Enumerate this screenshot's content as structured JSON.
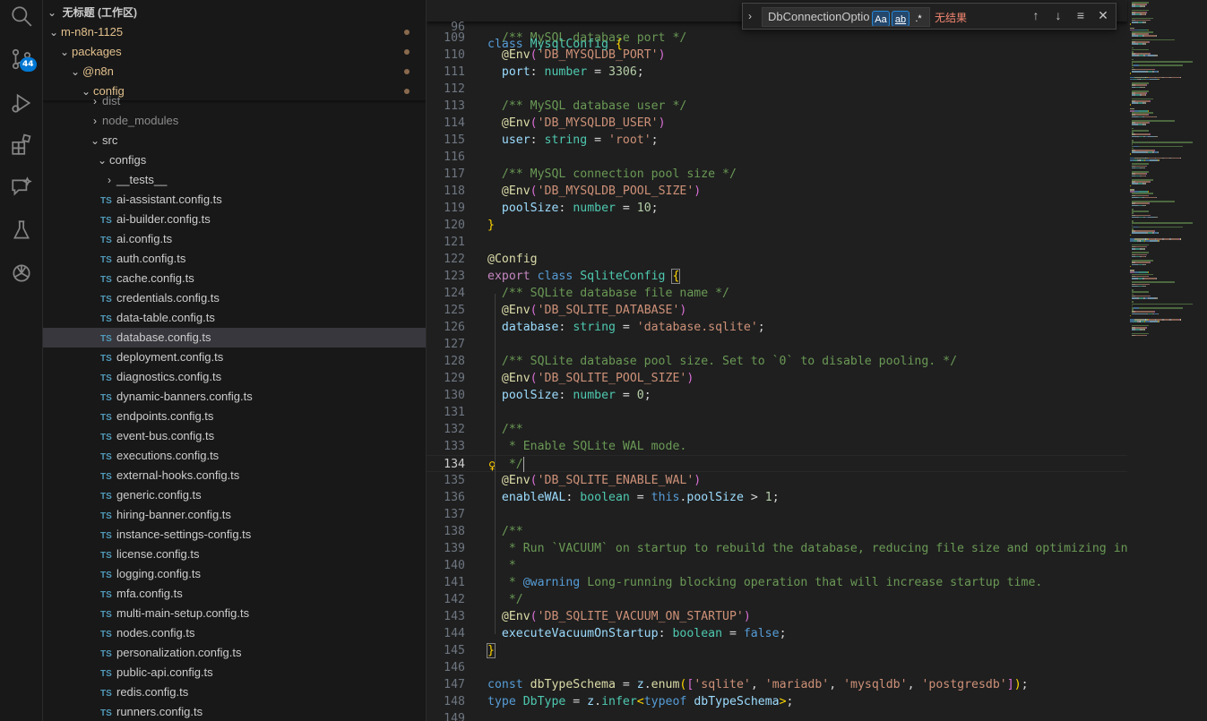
{
  "activity_bar": {
    "items": [
      {
        "name": "search-icon"
      },
      {
        "name": "source-control-icon",
        "badge": "44"
      },
      {
        "name": "run-debug-icon"
      },
      {
        "name": "extensions-icon"
      },
      {
        "name": "chat-icon"
      },
      {
        "name": "testing-icon"
      },
      {
        "name": "openai-icon"
      }
    ]
  },
  "explorer": {
    "workspace": "无标题 (工作区)",
    "sticky": [
      {
        "label": "m-n8n-1125",
        "indent": 1
      },
      {
        "label": "packages",
        "indent": 2
      },
      {
        "label": "@n8n",
        "indent": 3
      },
      {
        "label": "config",
        "indent": 4
      }
    ],
    "tree": [
      {
        "label": "dist",
        "type": "folder",
        "open": false,
        "indent": 5
      },
      {
        "label": "node_modules",
        "type": "folder",
        "open": false,
        "indent": 5
      },
      {
        "label": "src",
        "type": "folder",
        "open": true,
        "indent": 5
      },
      {
        "label": "configs",
        "type": "folder",
        "open": true,
        "indent": 6
      },
      {
        "label": "__tests__",
        "type": "folder",
        "open": false,
        "indent": 7
      },
      {
        "label": "ai-assistant.config.ts",
        "type": "file",
        "indent": 7
      },
      {
        "label": "ai-builder.config.ts",
        "type": "file",
        "indent": 7
      },
      {
        "label": "ai.config.ts",
        "type": "file",
        "indent": 7
      },
      {
        "label": "auth.config.ts",
        "type": "file",
        "indent": 7
      },
      {
        "label": "cache.config.ts",
        "type": "file",
        "indent": 7
      },
      {
        "label": "credentials.config.ts",
        "type": "file",
        "indent": 7
      },
      {
        "label": "data-table.config.ts",
        "type": "file",
        "indent": 7
      },
      {
        "label": "database.config.ts",
        "type": "file",
        "indent": 7,
        "selected": true
      },
      {
        "label": "deployment.config.ts",
        "type": "file",
        "indent": 7
      },
      {
        "label": "diagnostics.config.ts",
        "type": "file",
        "indent": 7
      },
      {
        "label": "dynamic-banners.config.ts",
        "type": "file",
        "indent": 7
      },
      {
        "label": "endpoints.config.ts",
        "type": "file",
        "indent": 7
      },
      {
        "label": "event-bus.config.ts",
        "type": "file",
        "indent": 7
      },
      {
        "label": "executions.config.ts",
        "type": "file",
        "indent": 7
      },
      {
        "label": "external-hooks.config.ts",
        "type": "file",
        "indent": 7
      },
      {
        "label": "generic.config.ts",
        "type": "file",
        "indent": 7
      },
      {
        "label": "hiring-banner.config.ts",
        "type": "file",
        "indent": 7
      },
      {
        "label": "instance-settings-config.ts",
        "type": "file",
        "indent": 7
      },
      {
        "label": "license.config.ts",
        "type": "file",
        "indent": 7
      },
      {
        "label": "logging.config.ts",
        "type": "file",
        "indent": 7
      },
      {
        "label": "mfa.config.ts",
        "type": "file",
        "indent": 7
      },
      {
        "label": "multi-main-setup.config.ts",
        "type": "file",
        "indent": 7
      },
      {
        "label": "nodes.config.ts",
        "type": "file",
        "indent": 7
      },
      {
        "label": "personalization.config.ts",
        "type": "file",
        "indent": 7
      },
      {
        "label": "public-api.config.ts",
        "type": "file",
        "indent": 7
      },
      {
        "label": "redis.config.ts",
        "type": "file",
        "indent": 7
      },
      {
        "label": "runners.config.ts",
        "type": "file",
        "indent": 7
      }
    ],
    "file_badge": "TS"
  },
  "find_widget": {
    "query": "DbConnectionOptio",
    "match_case_label": "Aa",
    "whole_word_label": "ab",
    "regex_label": ".*",
    "result": "无结果"
  },
  "editor": {
    "sticky_line": {
      "num": "96",
      "tokens": [
        [
          "kw",
          "class "
        ],
        [
          "cls",
          "MysqlConfig "
        ],
        [
          "br1",
          "{"
        ]
      ]
    },
    "current_line": "134",
    "lines": [
      {
        "num": "109",
        "tokens": [
          [
            "pl",
            "  "
          ],
          [
            "cmt",
            "/** MySQL database port */"
          ]
        ]
      },
      {
        "num": "110",
        "tokens": [
          [
            "pl",
            "  "
          ],
          [
            "dec",
            "@Env"
          ],
          [
            "br2",
            "("
          ],
          [
            "str",
            "'DB_MYSQLDB_PORT'"
          ],
          [
            "br2",
            ")"
          ]
        ]
      },
      {
        "num": "111",
        "tokens": [
          [
            "pl",
            "  "
          ],
          [
            "prop",
            "port"
          ],
          [
            "pl",
            ": "
          ],
          [
            "cls",
            "number"
          ],
          [
            "pl",
            " = "
          ],
          [
            "num",
            "3306"
          ],
          [
            "pl",
            ";"
          ]
        ]
      },
      {
        "num": "112",
        "tokens": []
      },
      {
        "num": "113",
        "tokens": [
          [
            "pl",
            "  "
          ],
          [
            "cmt",
            "/** MySQL database user */"
          ]
        ]
      },
      {
        "num": "114",
        "tokens": [
          [
            "pl",
            "  "
          ],
          [
            "dec",
            "@Env"
          ],
          [
            "br2",
            "("
          ],
          [
            "str",
            "'DB_MYSQLDB_USER'"
          ],
          [
            "br2",
            ")"
          ]
        ]
      },
      {
        "num": "115",
        "tokens": [
          [
            "pl",
            "  "
          ],
          [
            "prop",
            "user"
          ],
          [
            "pl",
            ": "
          ],
          [
            "cls",
            "string"
          ],
          [
            "pl",
            " = "
          ],
          [
            "str",
            "'root'"
          ],
          [
            "pl",
            ";"
          ]
        ]
      },
      {
        "num": "116",
        "tokens": []
      },
      {
        "num": "117",
        "tokens": [
          [
            "pl",
            "  "
          ],
          [
            "cmt",
            "/** MySQL connection pool size */"
          ]
        ]
      },
      {
        "num": "118",
        "tokens": [
          [
            "pl",
            "  "
          ],
          [
            "dec",
            "@Env"
          ],
          [
            "br2",
            "("
          ],
          [
            "str",
            "'DB_MYSQLDB_POOL_SIZE'"
          ],
          [
            "br2",
            ")"
          ]
        ]
      },
      {
        "num": "119",
        "tokens": [
          [
            "pl",
            "  "
          ],
          [
            "prop",
            "poolSize"
          ],
          [
            "pl",
            ": "
          ],
          [
            "cls",
            "number"
          ],
          [
            "pl",
            " = "
          ],
          [
            "num",
            "10"
          ],
          [
            "pl",
            ";"
          ]
        ]
      },
      {
        "num": "120",
        "tokens": [
          [
            "br1",
            "}"
          ]
        ]
      },
      {
        "num": "121",
        "tokens": []
      },
      {
        "num": "122",
        "tokens": [
          [
            "dec",
            "@Config"
          ]
        ]
      },
      {
        "num": "123",
        "tokens": [
          [
            "kw2",
            "export "
          ],
          [
            "kw",
            "class "
          ],
          [
            "cls",
            "SqliteConfig "
          ],
          [
            "br1box",
            "{"
          ]
        ]
      },
      {
        "num": "124",
        "tokens": [
          [
            "pl",
            "  "
          ],
          [
            "cmt",
            "/** SQLite database file name */"
          ]
        ]
      },
      {
        "num": "125",
        "tokens": [
          [
            "pl",
            "  "
          ],
          [
            "dec",
            "@Env"
          ],
          [
            "br2",
            "("
          ],
          [
            "str",
            "'DB_SQLITE_DATABASE'"
          ],
          [
            "br2",
            ")"
          ]
        ]
      },
      {
        "num": "126",
        "tokens": [
          [
            "pl",
            "  "
          ],
          [
            "prop",
            "database"
          ],
          [
            "pl",
            ": "
          ],
          [
            "cls",
            "string"
          ],
          [
            "pl",
            " = "
          ],
          [
            "str",
            "'database.sqlite'"
          ],
          [
            "pl",
            ";"
          ]
        ]
      },
      {
        "num": "127",
        "tokens": []
      },
      {
        "num": "128",
        "tokens": [
          [
            "pl",
            "  "
          ],
          [
            "cmt",
            "/** SQLite database pool size. Set to `0` to disable pooling. */"
          ]
        ]
      },
      {
        "num": "129",
        "tokens": [
          [
            "pl",
            "  "
          ],
          [
            "dec",
            "@Env"
          ],
          [
            "br2",
            "("
          ],
          [
            "str",
            "'DB_SQLITE_POOL_SIZE'"
          ],
          [
            "br2",
            ")"
          ]
        ]
      },
      {
        "num": "130",
        "tokens": [
          [
            "pl",
            "  "
          ],
          [
            "prop",
            "poolSize"
          ],
          [
            "pl",
            ": "
          ],
          [
            "cls",
            "number"
          ],
          [
            "pl",
            " = "
          ],
          [
            "num",
            "0"
          ],
          [
            "pl",
            ";"
          ]
        ]
      },
      {
        "num": "131",
        "tokens": []
      },
      {
        "num": "132",
        "tokens": [
          [
            "pl",
            "  "
          ],
          [
            "cmt",
            "/**"
          ]
        ]
      },
      {
        "num": "133",
        "tokens": [
          [
            "pl",
            "  "
          ],
          [
            "cmt",
            " * Enable SQLite WAL mode."
          ]
        ]
      },
      {
        "num": "134",
        "tokens": [
          [
            "pl",
            "  "
          ],
          [
            "cmt",
            " */"
          ]
        ]
      },
      {
        "num": "135",
        "tokens": [
          [
            "pl",
            "  "
          ],
          [
            "dec",
            "@Env"
          ],
          [
            "br2",
            "("
          ],
          [
            "str",
            "'DB_SQLITE_ENABLE_WAL'"
          ],
          [
            "br2",
            ")"
          ]
        ]
      },
      {
        "num": "136",
        "tokens": [
          [
            "pl",
            "  "
          ],
          [
            "prop",
            "enableWAL"
          ],
          [
            "pl",
            ": "
          ],
          [
            "cls",
            "boolean"
          ],
          [
            "pl",
            " = "
          ],
          [
            "kw",
            "this"
          ],
          [
            "pl",
            "."
          ],
          [
            "prop",
            "poolSize"
          ],
          [
            "pl",
            " > "
          ],
          [
            "num",
            "1"
          ],
          [
            "pl",
            ";"
          ]
        ]
      },
      {
        "num": "137",
        "tokens": []
      },
      {
        "num": "138",
        "tokens": [
          [
            "pl",
            "  "
          ],
          [
            "cmt",
            "/**"
          ]
        ]
      },
      {
        "num": "139",
        "tokens": [
          [
            "pl",
            "  "
          ],
          [
            "cmt",
            " * Run `VACUUM` on startup to rebuild the database, reducing file size and optimizing index"
          ]
        ]
      },
      {
        "num": "140",
        "tokens": [
          [
            "pl",
            "  "
          ],
          [
            "cmt",
            " *"
          ]
        ]
      },
      {
        "num": "141",
        "tokens": [
          [
            "pl",
            "  "
          ],
          [
            "cmt",
            " * "
          ],
          [
            "tag",
            "@warning"
          ],
          [
            "cmt",
            " Long-running blocking operation that will increase startup time."
          ]
        ]
      },
      {
        "num": "142",
        "tokens": [
          [
            "pl",
            "  "
          ],
          [
            "cmt",
            " */"
          ]
        ]
      },
      {
        "num": "143",
        "tokens": [
          [
            "pl",
            "  "
          ],
          [
            "dec",
            "@Env"
          ],
          [
            "br2",
            "("
          ],
          [
            "str",
            "'DB_SQLITE_VACUUM_ON_STARTUP'"
          ],
          [
            "br2",
            ")"
          ]
        ]
      },
      {
        "num": "144",
        "tokens": [
          [
            "pl",
            "  "
          ],
          [
            "prop",
            "executeVacuumOnStartup"
          ],
          [
            "pl",
            ": "
          ],
          [
            "cls",
            "boolean"
          ],
          [
            "pl",
            " = "
          ],
          [
            "kw",
            "false"
          ],
          [
            "pl",
            ";"
          ]
        ]
      },
      {
        "num": "145",
        "tokens": [
          [
            "br1box",
            "}"
          ]
        ]
      },
      {
        "num": "146",
        "tokens": []
      },
      {
        "num": "147",
        "tokens": [
          [
            "kw",
            "const "
          ],
          [
            "fn",
            "dbTypeSchema"
          ],
          [
            "pl",
            " = "
          ],
          [
            "var",
            "z"
          ],
          [
            "pl",
            "."
          ],
          [
            "fn",
            "enum"
          ],
          [
            "br1",
            "("
          ],
          [
            "br2",
            "["
          ],
          [
            "str",
            "'sqlite'"
          ],
          [
            "pl",
            ", "
          ],
          [
            "str",
            "'mariadb'"
          ],
          [
            "pl",
            ", "
          ],
          [
            "str",
            "'mysqldb'"
          ],
          [
            "pl",
            ", "
          ],
          [
            "str",
            "'postgresdb'"
          ],
          [
            "br2",
            "]"
          ],
          [
            "br1",
            ")"
          ],
          [
            "pl",
            ";"
          ]
        ]
      },
      {
        "num": "148",
        "tokens": [
          [
            "kw",
            "type "
          ],
          [
            "cls",
            "DbType"
          ],
          [
            "pl",
            " = "
          ],
          [
            "var",
            "z"
          ],
          [
            "pl",
            "."
          ],
          [
            "cls",
            "infer"
          ],
          [
            "br1",
            "<"
          ],
          [
            "kw",
            "typeof "
          ],
          [
            "var",
            "dbTypeSchema"
          ],
          [
            "br1",
            ">"
          ],
          [
            "pl",
            ";"
          ]
        ]
      },
      {
        "num": "149",
        "tokens": []
      }
    ]
  }
}
